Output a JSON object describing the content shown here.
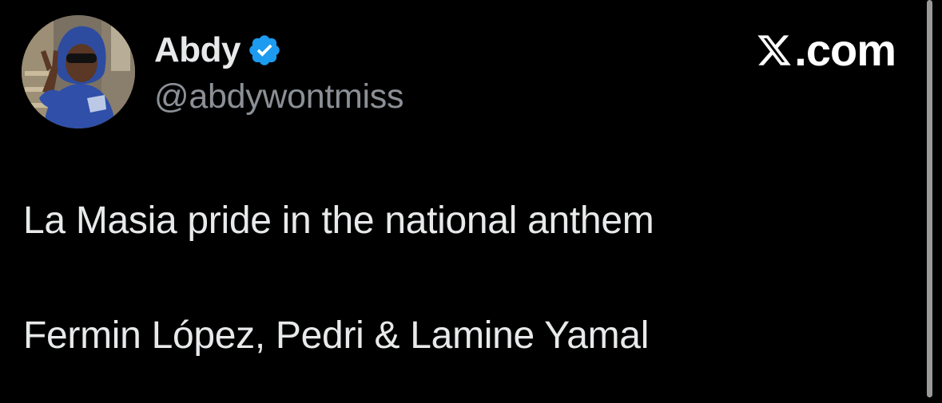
{
  "author": {
    "display_name": "Abdy",
    "handle": "@abdywontmiss",
    "verified": true,
    "verified_color": "#1d9bf0",
    "avatar_icon": "profile-photo"
  },
  "brand": {
    "logo_icon": "x-logo-icon",
    "label": ".com"
  },
  "tweet": {
    "lines": [
      "La Masia pride in the national anthem",
      "Fermin López, Pedri & Lamine Yamal"
    ]
  },
  "theme": {
    "background": "#000000",
    "text": "#e7e9ea",
    "secondary_text": "#8b9096"
  }
}
